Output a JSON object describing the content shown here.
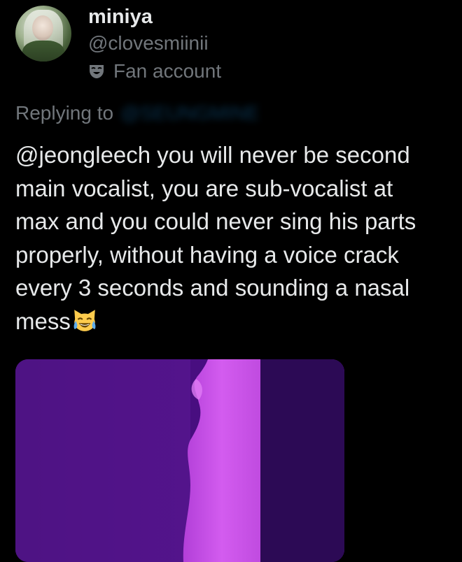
{
  "author": {
    "display_name": "miniya",
    "handle": "@clovesmiinii",
    "label": "Fan account",
    "label_icon": "theater-mask-icon"
  },
  "reply": {
    "prefix": "Replying to",
    "target": "@SEUNGMINE"
  },
  "tweet": {
    "text": "@jeongleech you will never be second\nmain vocalist, you are sub-vocalist at\nmax and you could never sing his parts\nproperly, without having a voice crack\nevery 3 seconds and sounding a nasal\nmess",
    "emoji": "grinning-cat-with-tears-of-joy"
  },
  "media": {
    "type": "video-thumbnail",
    "accent_color": "#c94ee6"
  },
  "colors": {
    "background": "#000000",
    "primary_text": "#e7e9ea",
    "secondary_text": "#71767b",
    "link": "#1d9bf0"
  }
}
